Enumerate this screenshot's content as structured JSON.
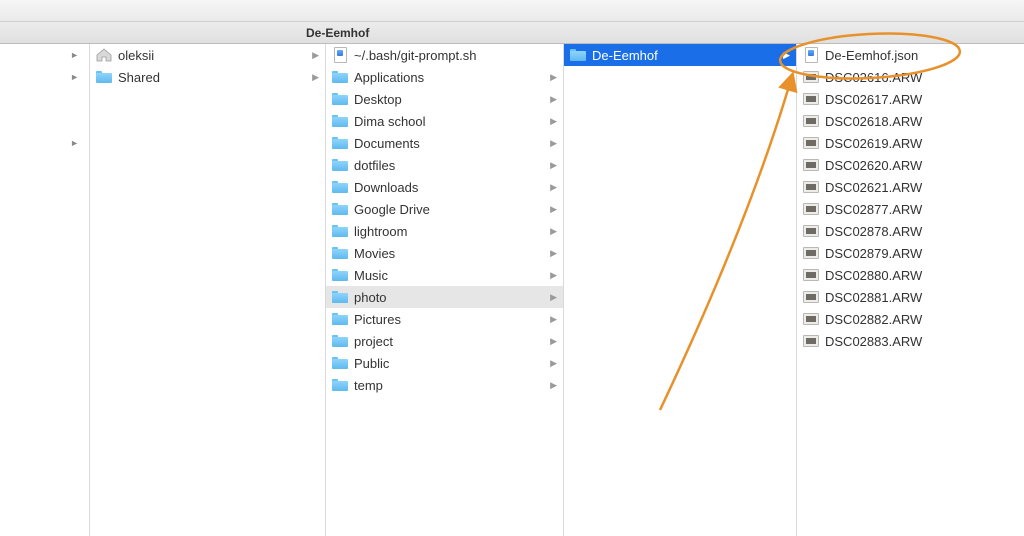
{
  "title": "De-Eemhof",
  "col0_rows": [
    "►",
    "►",
    "►"
  ],
  "col1": {
    "selected_index": 0,
    "items": [
      {
        "label": "oleksii",
        "icon": "home",
        "has_children": true
      },
      {
        "label": "Shared",
        "icon": "folder",
        "has_children": true
      }
    ]
  },
  "col2": {
    "path_index": 10,
    "items": [
      {
        "label": "~/.bash/git-prompt.sh",
        "icon": "doc",
        "has_children": false
      },
      {
        "label": "Applications",
        "icon": "folder",
        "has_children": true
      },
      {
        "label": "Desktop",
        "icon": "folder",
        "has_children": true
      },
      {
        "label": "Dima school",
        "icon": "folder",
        "has_children": true
      },
      {
        "label": "Documents",
        "icon": "folder",
        "has_children": true
      },
      {
        "label": "dotfiles",
        "icon": "folder",
        "has_children": true
      },
      {
        "label": "Downloads",
        "icon": "folder",
        "has_children": true
      },
      {
        "label": "Google Drive",
        "icon": "folder",
        "has_children": true
      },
      {
        "label": "lightroom",
        "icon": "folder",
        "has_children": true
      },
      {
        "label": "Movies",
        "icon": "folder",
        "has_children": true
      },
      {
        "label": "Music",
        "icon": "folder",
        "has_children": true
      },
      {
        "label": "photo",
        "icon": "folder",
        "has_children": true
      },
      {
        "label": "Pictures",
        "icon": "folder",
        "has_children": true
      },
      {
        "label": "project",
        "icon": "folder",
        "has_children": true
      },
      {
        "label": "Public",
        "icon": "folder",
        "has_children": true
      },
      {
        "label": "temp",
        "icon": "folder",
        "has_children": true
      }
    ]
  },
  "col3": {
    "selected_index": 0,
    "items": [
      {
        "label": "De-Eemhof",
        "icon": "folder",
        "has_children": true
      }
    ]
  },
  "col4": {
    "items": [
      {
        "label": "De-Eemhof.json",
        "icon": "doc"
      },
      {
        "label": "DSC02616.ARW",
        "icon": "arw"
      },
      {
        "label": "DSC02617.ARW",
        "icon": "arw"
      },
      {
        "label": "DSC02618.ARW",
        "icon": "arw"
      },
      {
        "label": "DSC02619.ARW",
        "icon": "arw"
      },
      {
        "label": "DSC02620.ARW",
        "icon": "arw"
      },
      {
        "label": "DSC02621.ARW",
        "icon": "arw"
      },
      {
        "label": "DSC02877.ARW",
        "icon": "arw"
      },
      {
        "label": "DSC02878.ARW",
        "icon": "arw"
      },
      {
        "label": "DSC02879.ARW",
        "icon": "arw"
      },
      {
        "label": "DSC02880.ARW",
        "icon": "arw"
      },
      {
        "label": "DSC02881.ARW",
        "icon": "arw"
      },
      {
        "label": "DSC02882.ARW",
        "icon": "arw"
      },
      {
        "label": "DSC02883.ARW",
        "icon": "arw"
      }
    ]
  },
  "annotation": {
    "color": "#e8912a",
    "target_label": "De-Eemhof.json"
  }
}
